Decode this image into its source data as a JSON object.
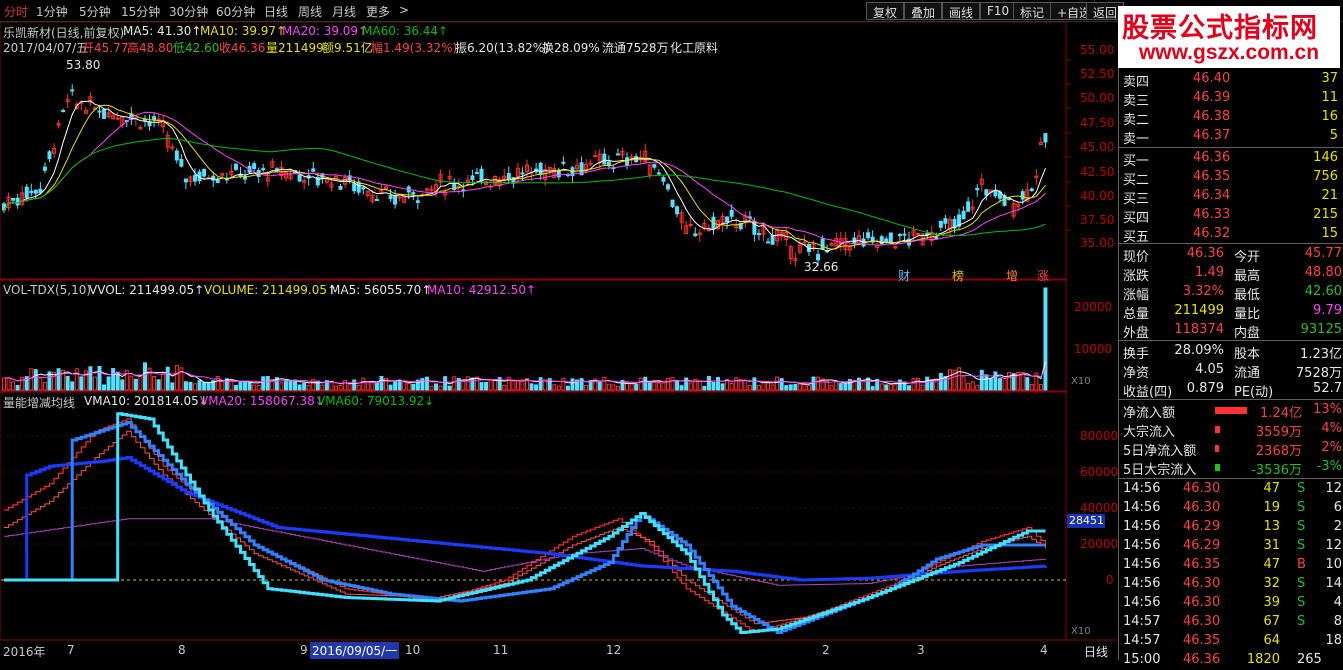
{
  "toolbar": {
    "tabs": [
      "分时",
      "1分钟",
      "5分钟",
      "15分钟",
      "30分钟",
      "60分钟",
      "日线",
      "周线",
      "月线",
      "更多"
    ],
    "more_arrow": ">",
    "buttons": [
      "复权",
      "叠加",
      "画线",
      "F10",
      "标记",
      "+自选",
      "返回"
    ]
  },
  "logo": {
    "line1": "股票公式指标网",
    "line2": "www.gszx.com.cn"
  },
  "price_panel": {
    "title": "乐凯新材(日线,前复权)",
    "ma5": "MA5: 41.30↑",
    "ma10": "MA10: 39.97↑",
    "ma20": "MA20: 39.09↑",
    "ma60": "MA60: 36.44↑",
    "info": {
      "date": "2017/04/07/五",
      "open": "开45.77",
      "high": "高48.80",
      "low": "低42.60",
      "close": "收46.36",
      "vol": "量211499",
      "amt": "额9.51亿",
      "chg": "幅1.49(3.32%)",
      "amp": "振6.20(13.82%)",
      "turn": "换28.09%",
      "float": "流通7528万",
      "sector": "化工原料"
    },
    "high_label": "53.80",
    "low_label": "32.66",
    "y_ticks": [
      "55.00",
      "52.50",
      "50.00",
      "47.50",
      "45.00",
      "42.50",
      "40.00",
      "37.50",
      "35.00"
    ],
    "badges": [
      "财",
      "榜",
      "增",
      "涨"
    ]
  },
  "volume_panel": {
    "title": "VOL-TDX(5,10)",
    "vvol": "VVOL: 211499.05↑",
    "volume": "VOLUME: 211499.05↑",
    "ma5": "MA5: 56055.70↑",
    "ma10": "MA10: 42912.50↑",
    "y_ticks": [
      "20000",
      "10000"
    ],
    "unit": "X10"
  },
  "indicator_panel": {
    "title": "量能增减均线",
    "vma10": "VMA10: 201814.05↓",
    "vma20": "VMA20: 158067.38↓",
    "vma60": "VMA60: 79013.92↓",
    "y_ticks": [
      "80000",
      "60000",
      "40000",
      "20000",
      "0"
    ],
    "highlight_value": "28451",
    "unit": "X10"
  },
  "x_axis": {
    "labels": [
      "2016年",
      "7",
      "8",
      "9",
      "10",
      "11",
      "12",
      "2",
      "3",
      "4"
    ],
    "cursor_date": "2016/09/05/一",
    "period": "日线"
  },
  "quote": {
    "asks": [
      {
        "label": "卖五",
        "price": "46.41",
        "vol": "13"
      },
      {
        "label": "卖四",
        "price": "46.40",
        "vol": "37"
      },
      {
        "label": "卖三",
        "price": "46.39",
        "vol": "11"
      },
      {
        "label": "卖二",
        "price": "46.38",
        "vol": "16"
      },
      {
        "label": "卖一",
        "price": "46.37",
        "vol": "5"
      }
    ],
    "bids": [
      {
        "label": "买一",
        "price": "46.36",
        "vol": "146"
      },
      {
        "label": "买二",
        "price": "46.35",
        "vol": "756"
      },
      {
        "label": "买三",
        "price": "46.34",
        "vol": "21"
      },
      {
        "label": "买四",
        "price": "46.33",
        "vol": "215"
      },
      {
        "label": "买五",
        "price": "46.32",
        "vol": "15"
      }
    ],
    "stats": [
      {
        "l1": "现价",
        "v1": "46.36",
        "l2": "今开",
        "v2": "45.77"
      },
      {
        "l1": "涨跌",
        "v1": "1.49",
        "l2": "最高",
        "v2": "48.80"
      },
      {
        "l1": "涨幅",
        "v1": "3.32%",
        "l2": "最低",
        "v2": "42.60"
      },
      {
        "l1": "总量",
        "v1": "211499",
        "l2": "量比",
        "v2": "9.79"
      },
      {
        "l1": "外盘",
        "v1": "118374",
        "l2": "内盘",
        "v2": "93125"
      }
    ],
    "stats2": [
      {
        "l1": "换手",
        "v1": "28.09%",
        "l2": "股本",
        "v2": "1.23亿"
      },
      {
        "l1": "净资",
        "v1": "4.05",
        "l2": "流通",
        "v2": "7528万"
      },
      {
        "l1": "收益(四)",
        "v1": "0.879",
        "l2": "PE(动)",
        "v2": "52.7"
      }
    ],
    "flows": [
      {
        "label": "净流入额",
        "value": "1.24亿",
        "pct": "13%",
        "bar": 1.0
      },
      {
        "label": "大宗流入",
        "value": "3559万",
        "pct": "4%",
        "bar": 0.15
      },
      {
        "label": "5日净流入额",
        "value": "2368万",
        "pct": "2%",
        "bar": 0.1
      },
      {
        "label": "5日大宗流入",
        "value": "-3536万",
        "pct": "-3%",
        "bar": 0.15
      }
    ],
    "trades": [
      {
        "t": "14:56",
        "p": "46.30",
        "v": "47",
        "d": "S"
      },
      {
        "t": "14:56",
        "p": "46.30",
        "v": "19",
        "d": "S"
      },
      {
        "t": "14:56",
        "p": "46.29",
        "v": "13",
        "d": "S"
      },
      {
        "t": "14:56",
        "p": "46.29",
        "v": "31",
        "d": "S"
      },
      {
        "t": "14:56",
        "p": "46.35",
        "v": "47",
        "d": "B"
      },
      {
        "t": "14:56",
        "p": "46.30",
        "v": "32",
        "d": "S"
      },
      {
        "t": "14:56",
        "p": "46.30",
        "v": "39",
        "d": "S"
      },
      {
        "t": "14:57",
        "p": "46.30",
        "v": "67",
        "d": "S"
      },
      {
        "t": "14:57",
        "p": "46.35",
        "v": "64",
        "d": ""
      },
      {
        "t": "15:00",
        "p": "46.36",
        "v": "1820",
        "d": "265"
      }
    ],
    "trade_counts": [
      "12",
      "6",
      "2",
      "12",
      "10",
      "14",
      "4",
      "8",
      "18",
      ""
    ]
  },
  "colors": {
    "up": "#ff3030",
    "down": "#55e0ff",
    "ma5": "#ffffff",
    "ma10": "#e8e000",
    "ma20": "#ff40ff",
    "ma60": "#00c000",
    "vma_fast": "#ff2a2a",
    "vma_blue": "#1a3cff"
  }
}
